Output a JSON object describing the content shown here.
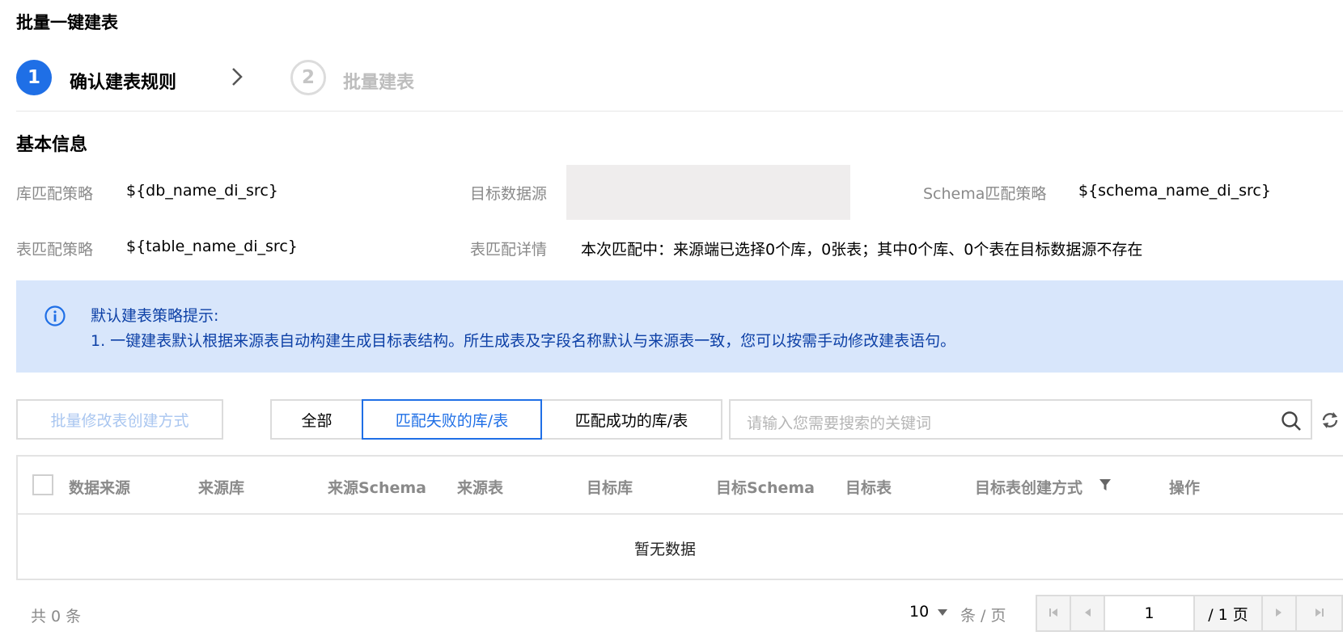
{
  "page": {
    "title": "批量一键建表"
  },
  "steps": [
    {
      "number": "1",
      "label": "确认建表规则",
      "active": true
    },
    {
      "number": "2",
      "label": "批量建表",
      "active": false
    }
  ],
  "basic_info": {
    "title": "基本信息",
    "db_match_label": "库匹配策略",
    "db_match_value": "${db_name_di_src}",
    "target_source_label": "目标数据源",
    "schema_match_label": "Schema匹配策略",
    "schema_match_value": "${schema_name_di_src}",
    "table_match_label": "表匹配策略",
    "table_match_value": "${table_name_di_src}",
    "table_match_detail_label": "表匹配详情",
    "table_match_detail_value": "本次匹配中：来源端已选择0个库，0张表；其中0个库、0个表在目标数据源不存在"
  },
  "alert": {
    "icon": "info-icon",
    "title": "默认建表策略提示:",
    "line1": "1. 一键建表默认根据来源表自动构建生成目标表结构。所生成表及字段名称默认与来源表一致，您可以按需手动修改建表语句。"
  },
  "toolbar": {
    "batch_modify_label": "批量修改表创建方式",
    "filter_all": "全部",
    "filter_failed": "匹配失败的库/表",
    "filter_success": "匹配成功的库/表",
    "search_placeholder": "请输入您需要搜索的关键词"
  },
  "table": {
    "columns": [
      "数据来源",
      "来源库",
      "来源Schema",
      "来源表",
      "目标库",
      "目标Schema",
      "目标表",
      "目标表创建方式",
      "操作"
    ],
    "empty_text": "暂无数据"
  },
  "pagination": {
    "total_text": "共 0 条",
    "page_size": "10",
    "page_size_unit": "条 / 页",
    "current_page": "1",
    "total_pages_text": "/ 1 页"
  },
  "colors": {
    "accent": "#1f6fe6",
    "alert_bg": "#d8e6fb",
    "alert_text": "#0d40a6"
  }
}
